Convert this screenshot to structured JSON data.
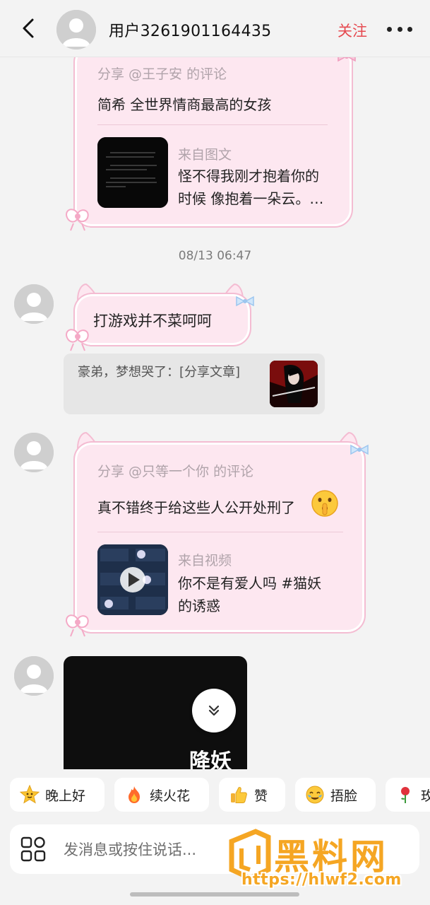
{
  "header": {
    "title": "用户3261901164435",
    "follow_label": "关注"
  },
  "messages": {
    "share1": {
      "head": "分享 @王子安 的评论",
      "text": "简希 全世界情商最高的女孩",
      "source_label": "来自图文",
      "source_line1": "怪不得我刚才抱着你的",
      "source_line2": "时候 像抱着一朵云。…"
    },
    "timestamp": "08/13 06:47",
    "text1": "打游戏并不菜呵呵",
    "quote": "豪弟，梦想哭了：[分享文章]",
    "share2": {
      "head": "分享 @只等一个你 的评论",
      "text": "真不错终于给这些人公开处刑了",
      "source_label": "来自视频",
      "source_line1": "你不是有爱人吗 #猫妖",
      "source_line2": "的诱惑"
    },
    "video_text": "降妖"
  },
  "quick_replies": [
    {
      "label": "晚上好",
      "icon": "star-face-icon"
    },
    {
      "label": "续火花",
      "icon": "fire-icon"
    },
    {
      "label": "赞",
      "icon": "thumbs-up-icon"
    },
    {
      "label": "捂脸",
      "icon": "facepalm-emoji-icon"
    },
    {
      "label": "玫",
      "icon": "rose-icon"
    }
  ],
  "input": {
    "placeholder": "发消息或按住说话..."
  },
  "watermark": {
    "text": "黑料网",
    "url": "https://hlwf2.com"
  },
  "colors": {
    "accent": "#e64a50",
    "bubble": "#fde7f0",
    "bubble_border": "#f4bcd2",
    "background": "#f3f3f3",
    "watermark": "#f5a623"
  }
}
